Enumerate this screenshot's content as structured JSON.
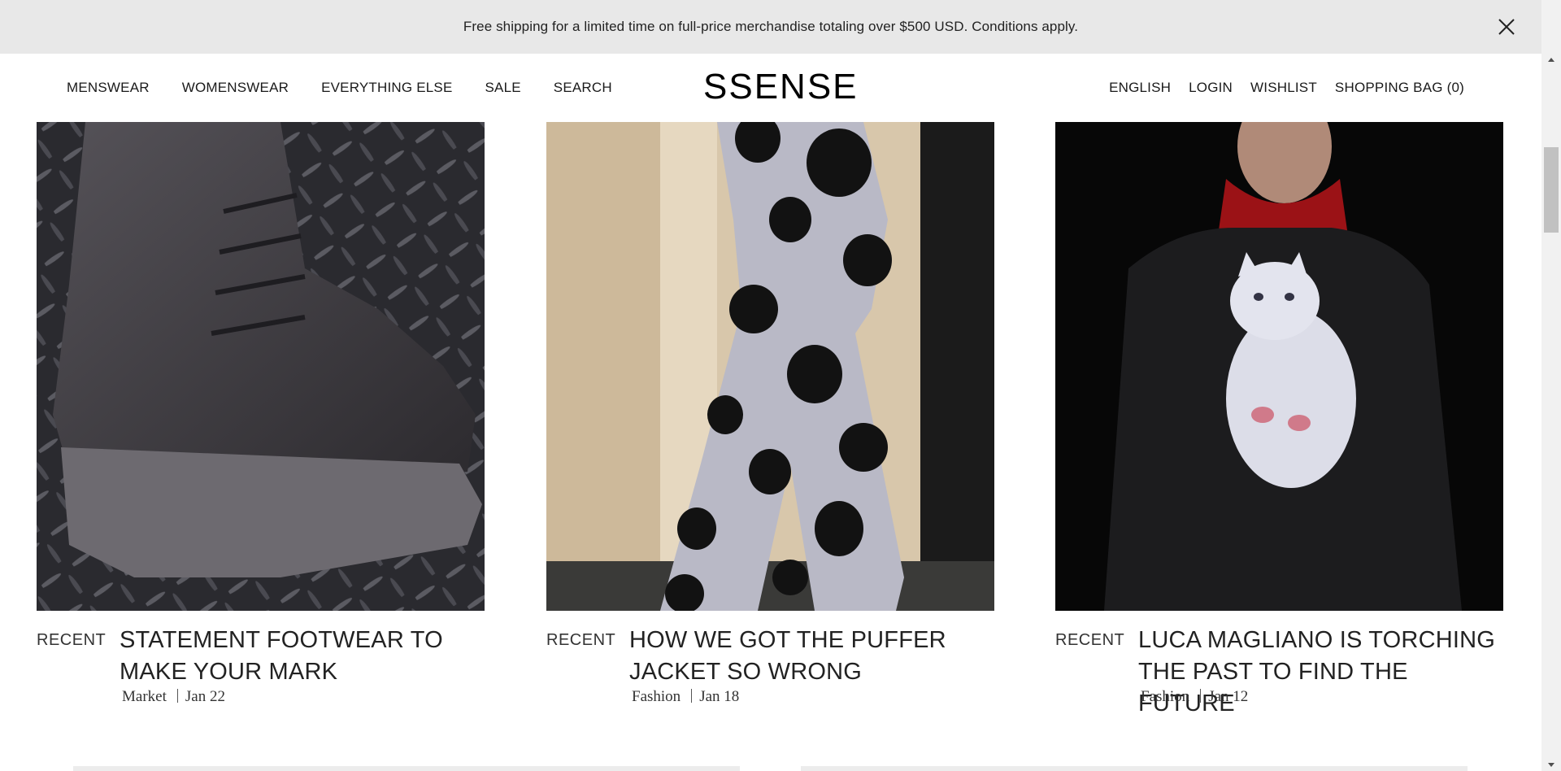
{
  "promo": {
    "text": "Free shipping for a limited time on full-price merchandise totaling over $500 USD. Conditions apply."
  },
  "header": {
    "logo": "SSENSE",
    "nav_left": [
      "MENSWEAR",
      "WOMENSWEAR",
      "EVERYTHING ELSE",
      "SALE",
      "SEARCH"
    ],
    "nav_right": [
      "ENGLISH",
      "LOGIN",
      "WISHLIST",
      "SHOPPING BAG (0)"
    ]
  },
  "articles": [
    {
      "tag": "RECENT",
      "title": "STATEMENT FOOTWEAR TO MAKE YOUR MARK",
      "category": "Market",
      "date": "Jan 22",
      "image": "black-boot-on-diamond-plate"
    },
    {
      "tag": "RECENT",
      "title": "HOW WE GOT THE PUFFER JACKET SO WRONG",
      "category": "Fashion",
      "date": "Jan 18",
      "image": "polka-dot-knit-outfit"
    },
    {
      "tag": "RECENT",
      "title": "LUCA MAGLIANO IS TORCHING THE PAST TO FIND THE FUTURE",
      "category": "Fashion",
      "date": "Jan 12",
      "image": "man-in-cat-sweater"
    }
  ],
  "colors": {
    "banner_bg": "#e8e8e8",
    "text": "#1a1a1a"
  }
}
